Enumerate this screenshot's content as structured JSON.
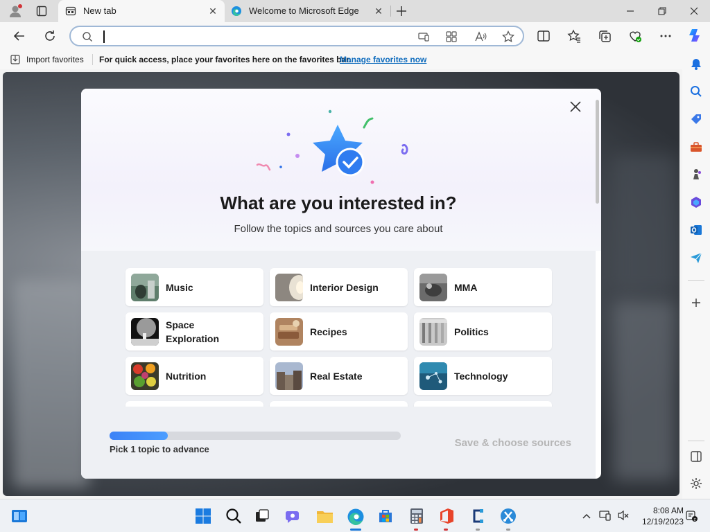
{
  "tabs": [
    {
      "title": "New tab",
      "active": true
    },
    {
      "title": "Welcome to Microsoft Edge",
      "active": false
    }
  ],
  "address_bar": {
    "value": "",
    "placeholder": ""
  },
  "favorites_bar": {
    "import_label": "Import favorites",
    "message": "For quick access, place your favorites here on the favorites bar.",
    "manage_link": "Manage favorites now"
  },
  "modal": {
    "title": "What are you interested in?",
    "subtitle": "Follow the topics and sources you care about",
    "topics": [
      {
        "label": "Music",
        "icon": "music-thumb"
      },
      {
        "label": "Interior Design",
        "icon": "interior-design-thumb"
      },
      {
        "label": "MMA",
        "icon": "mma-thumb"
      },
      {
        "label": "Space Exploration",
        "icon": "space-exploration-thumb"
      },
      {
        "label": "Recipes",
        "icon": "recipes-thumb"
      },
      {
        "label": "Politics",
        "icon": "politics-thumb"
      },
      {
        "label": "Nutrition",
        "icon": "nutrition-thumb"
      },
      {
        "label": "Real Estate",
        "icon": "real-estate-thumb"
      },
      {
        "label": "Technology",
        "icon": "technology-thumb"
      }
    ],
    "progress_fraction": 0.2,
    "progress_label": "Pick 1 topic to advance",
    "save_button": "Save & choose sources"
  },
  "taskbar": {
    "time": "8:08 AM",
    "date": "12/19/2023"
  },
  "colors": {
    "accent": "#3b82f6",
    "link": "#0f6cbd",
    "disabled_text": "#b5b5b5"
  }
}
